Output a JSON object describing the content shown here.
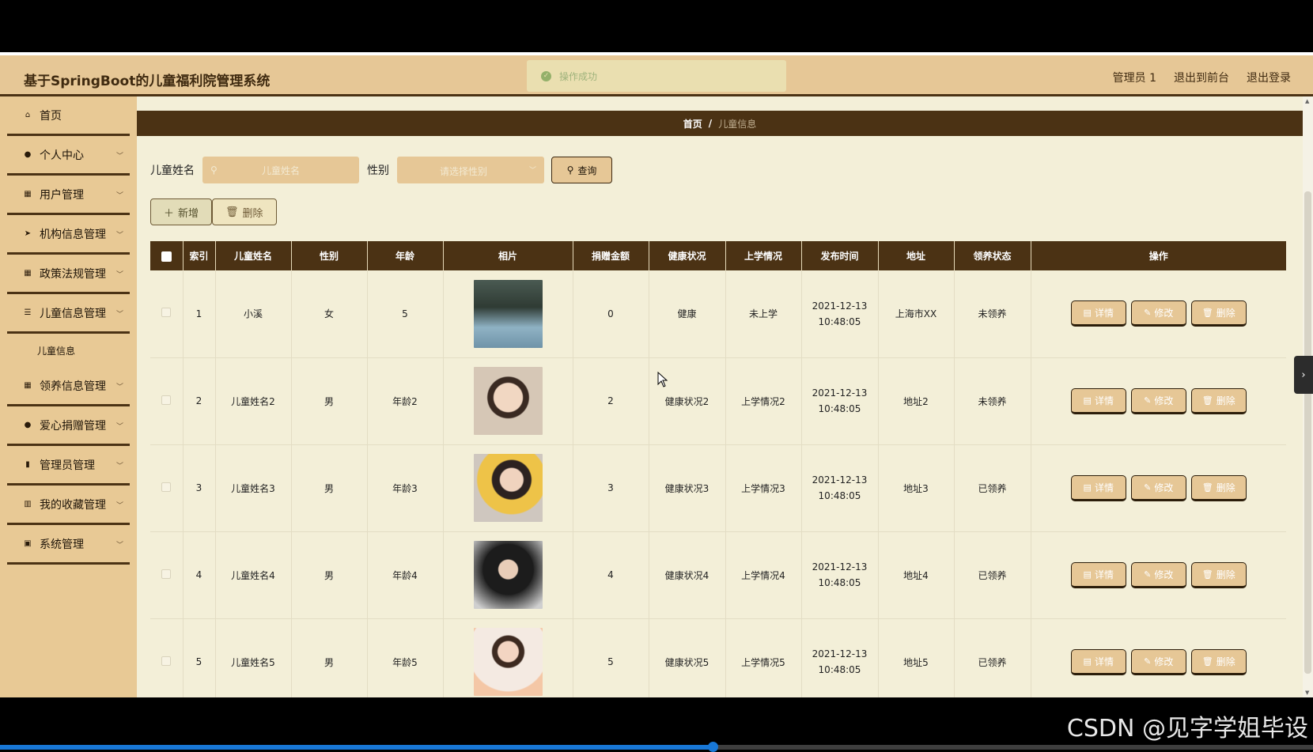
{
  "header": {
    "title": "基于SpringBoot的儿童福利院管理系统",
    "toast": "操作成功",
    "user": "管理员 1",
    "back_front": "退出到前台",
    "logout": "退出登录"
  },
  "sidebar": {
    "items": [
      {
        "label": "首页",
        "icon": "home-icon"
      },
      {
        "label": "个人中心",
        "icon": "user-icon"
      },
      {
        "label": "用户管理",
        "icon": "grid-icon"
      },
      {
        "label": "机构信息管理",
        "icon": "send-icon"
      },
      {
        "label": "政策法规管理",
        "icon": "grid-icon"
      },
      {
        "label": "儿童信息管理",
        "icon": "list-icon"
      },
      {
        "label": "领养信息管理",
        "icon": "grid-icon"
      },
      {
        "label": "爱心捐赠管理",
        "icon": "user-icon"
      },
      {
        "label": "管理员管理",
        "icon": "bar-icon"
      },
      {
        "label": "我的收藏管理",
        "icon": "chart-icon"
      },
      {
        "label": "系统管理",
        "icon": "clipboard-icon"
      }
    ],
    "sub_item": "儿童信息"
  },
  "breadcrumb": {
    "home": "首页",
    "sep": "/",
    "current": "儿童信息"
  },
  "search": {
    "name_label": "儿童姓名",
    "name_placeholder": "儿童姓名",
    "gender_label": "性别",
    "gender_placeholder": "请选择性别",
    "query": "查询"
  },
  "actions": {
    "add": "新增",
    "delete": "删除"
  },
  "table": {
    "headers": [
      "索引",
      "儿童姓名",
      "性别",
      "年龄",
      "相片",
      "捐赠金额",
      "健康状况",
      "上学情况",
      "发布时间",
      "地址",
      "领养状态",
      "操作"
    ],
    "rows": [
      {
        "idx": "1",
        "name": "小溪",
        "gender": "女",
        "age": "5",
        "amount": "0",
        "health": "健康",
        "school": "未上学",
        "time": "2021-12-13 10:48:05",
        "addr": "上海市XX",
        "status": "未领养"
      },
      {
        "idx": "2",
        "name": "儿童姓名2",
        "gender": "男",
        "age": "年龄2",
        "amount": "2",
        "health": "健康状况2",
        "school": "上学情况2",
        "time": "2021-12-13 10:48:05",
        "addr": "地址2",
        "status": "未领养"
      },
      {
        "idx": "3",
        "name": "儿童姓名3",
        "gender": "男",
        "age": "年龄3",
        "amount": "3",
        "health": "健康状况3",
        "school": "上学情况3",
        "time": "2021-12-13 10:48:05",
        "addr": "地址3",
        "status": "已领养"
      },
      {
        "idx": "4",
        "name": "儿童姓名4",
        "gender": "男",
        "age": "年龄4",
        "amount": "4",
        "health": "健康状况4",
        "school": "上学情况4",
        "time": "2021-12-13 10:48:05",
        "addr": "地址4",
        "status": "已领养"
      },
      {
        "idx": "5",
        "name": "儿童姓名5",
        "gender": "男",
        "age": "年龄5",
        "amount": "5",
        "health": "健康状况5",
        "school": "上学情况5",
        "time": "2021-12-13 10:48:05",
        "addr": "地址5",
        "status": "已领养"
      }
    ],
    "ops": {
      "detail": "详情",
      "edit": "修改",
      "delete": "删除"
    }
  },
  "watermark": "CSDN @见字学姐毕设",
  "video_progress": 0.543,
  "colors": {
    "header_bg": "#e6c796",
    "dark_brown": "#4b3214",
    "content_bg": "#f3efd8",
    "accent_btn": "#e6c796"
  }
}
